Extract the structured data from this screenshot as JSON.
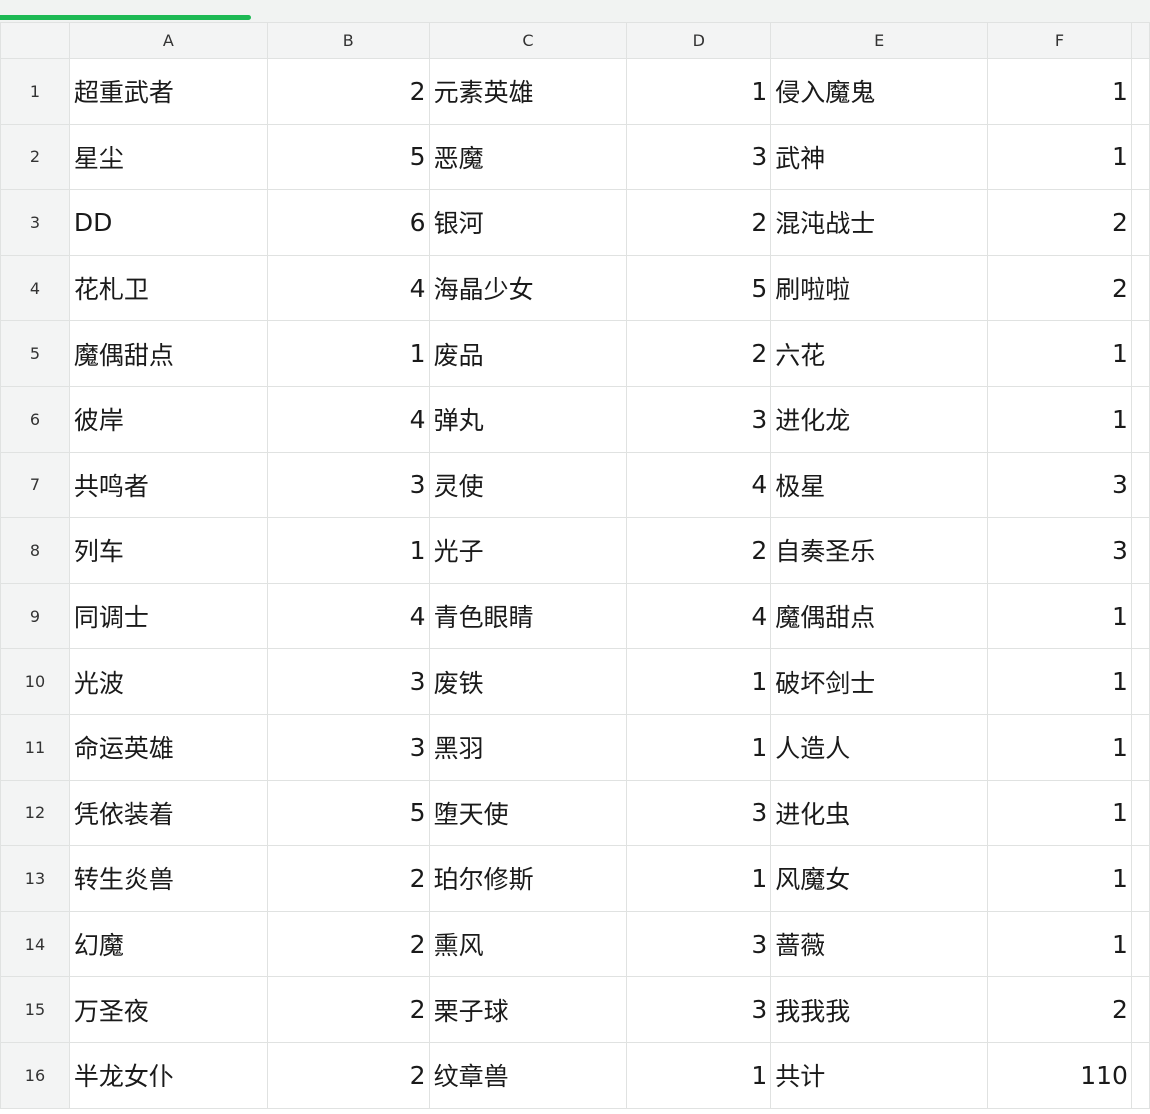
{
  "columns": [
    "A",
    "B",
    "C",
    "D",
    "E",
    "F"
  ],
  "rows": [
    {
      "n": "1",
      "a": "超重武者",
      "b": "2",
      "c": "元素英雄",
      "d": "1",
      "e": "侵入魔鬼",
      "f": "1"
    },
    {
      "n": "2",
      "a": "星尘",
      "b": "5",
      "c": "恶魔",
      "d": "3",
      "e": "武神",
      "f": "1"
    },
    {
      "n": "3",
      "a": "DD",
      "b": "6",
      "c": "银河",
      "d": "2",
      "e": "混沌战士",
      "f": "2"
    },
    {
      "n": "4",
      "a": "花札卫",
      "b": "4",
      "c": "海晶少女",
      "d": "5",
      "e": "刷啦啦",
      "f": "2"
    },
    {
      "n": "5",
      "a": "魔偶甜点",
      "b": "1",
      "c": "废品",
      "d": "2",
      "e": "六花",
      "f": "1"
    },
    {
      "n": "6",
      "a": "彼岸",
      "b": "4",
      "c": "弹丸",
      "d": "3",
      "e": "进化龙",
      "f": "1"
    },
    {
      "n": "7",
      "a": "共鸣者",
      "b": "3",
      "c": "灵使",
      "d": "4",
      "e": "极星",
      "f": "3"
    },
    {
      "n": "8",
      "a": "列车",
      "b": "1",
      "c": "光子",
      "d": "2",
      "e": "自奏圣乐",
      "f": "3"
    },
    {
      "n": "9",
      "a": "同调士",
      "b": "4",
      "c": "青色眼睛",
      "d": "4",
      "e": "魔偶甜点",
      "f": "1"
    },
    {
      "n": "10",
      "a": "光波",
      "b": "3",
      "c": "废铁",
      "d": "1",
      "e": "破坏剑士",
      "f": "1"
    },
    {
      "n": "11",
      "a": "命运英雄",
      "b": "3",
      "c": "黑羽",
      "d": "1",
      "e": "人造人",
      "f": "1"
    },
    {
      "n": "12",
      "a": "凭依装着",
      "b": "5",
      "c": "堕天使",
      "d": "3",
      "e": "进化虫",
      "f": "1"
    },
    {
      "n": "13",
      "a": "转生炎兽",
      "b": "2",
      "c": "珀尔修斯",
      "d": "1",
      "e": "风魔女",
      "f": "1"
    },
    {
      "n": "14",
      "a": "幻魔",
      "b": "2",
      "c": "熏风",
      "d": "3",
      "e": "蔷薇",
      "f": "1"
    },
    {
      "n": "15",
      "a": "万圣夜",
      "b": "2",
      "c": "栗子球",
      "d": "3",
      "e": "我我我",
      "f": "2"
    },
    {
      "n": "16",
      "a": "半龙女仆",
      "b": "2",
      "c": "纹章兽",
      "d": "1",
      "e": "共计",
      "f": "110"
    }
  ]
}
